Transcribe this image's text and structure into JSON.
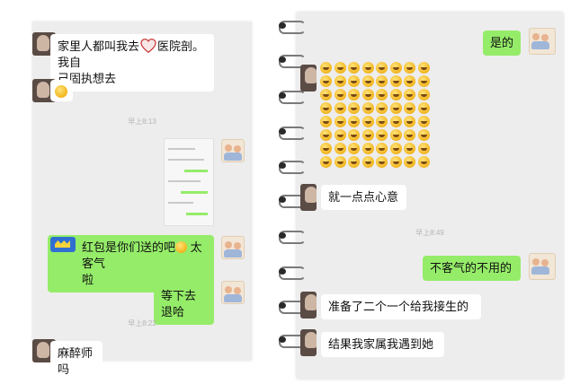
{
  "left_screenshot": {
    "msg_1": {
      "line1": "家里人都叫我去",
      "line1_after": "医院剖。我自",
      "line2": "己固执想去",
      "icon": "heart-icon"
    },
    "msg_2_icon": "laughing-emoji-icon",
    "timestamp_1": "早上8:13",
    "msg_4": {
      "text": "红包是你们送的吧",
      "after": "太客气",
      "line2": "啦",
      "icon": "red-packet-icon"
    },
    "msg_5": "等下去退哈",
    "timestamp_2": "早上8:22",
    "msg_6": "麻醉师吗"
  },
  "right_screenshot": {
    "msg_1": "是的",
    "emoji_icon": "laughing-emoji-icon",
    "msg_3": "就一点点心意",
    "timestamp_1": "早上8:49",
    "msg_4": "不客气的不用的",
    "msg_5": "准备了二个一个给我接生的",
    "msg_6": "结果我家属我遇到她"
  },
  "colors": {
    "sent_bubble": "#95ec69",
    "received_bubble": "#ffffff",
    "chat_background": "#ededed"
  }
}
